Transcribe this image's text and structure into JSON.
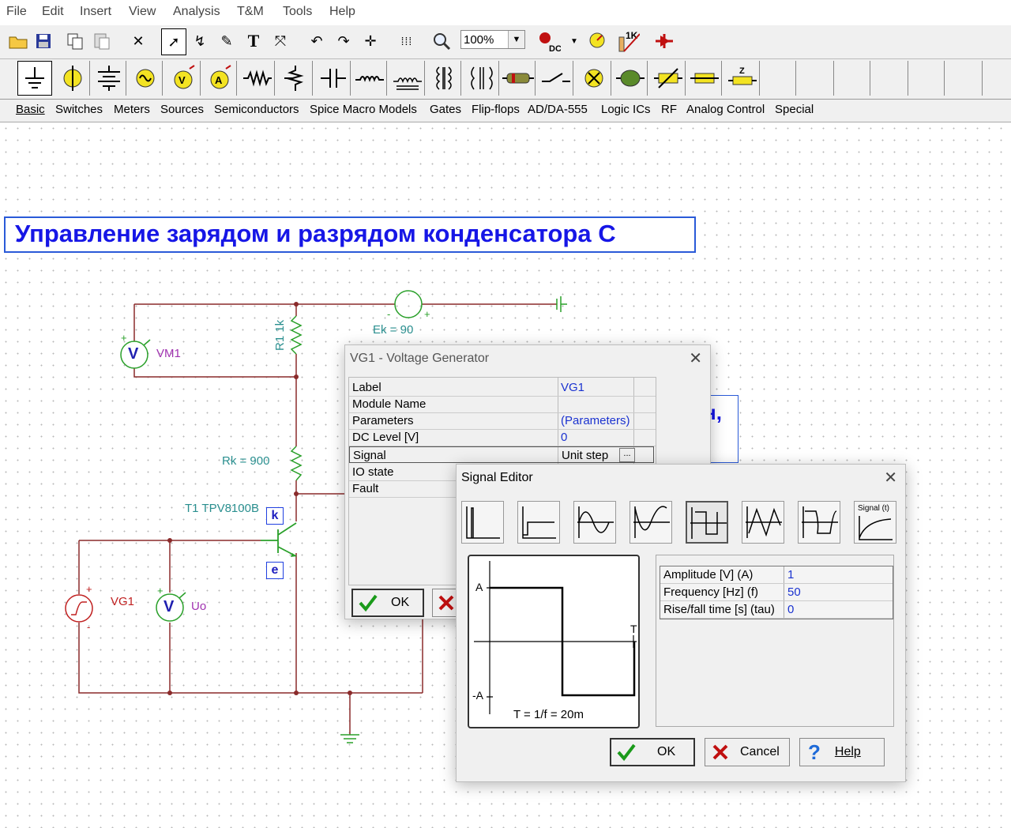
{
  "menu": [
    "File",
    "Edit",
    "Insert",
    "View",
    "Analysis",
    "T&M",
    "Tools",
    "Help"
  ],
  "toolbar": {
    "zoom": "100%"
  },
  "component_tabs": [
    "Basic",
    "Switches",
    "Meters",
    "Sources",
    "Semiconductors",
    "Spice Macro Models",
    "Gates",
    "Flip-flops",
    "AD/DA-555",
    "Logic ICs",
    "RF",
    "Analog Control",
    "Special"
  ],
  "schematic": {
    "title": "Управление зарядом и разрядом конденсатора С",
    "labels": {
      "ek": "Ek = 90",
      "r1": "R1 1k",
      "vm1": "VM1",
      "rk": "Rk = 900",
      "t1": "T1 TPV8100B",
      "k": "k",
      "e": "e",
      "vg1": "VG1",
      "uo": "Uo",
      "v": "V",
      "plus": "+",
      "minus": "-",
      "hidden_text": "н,"
    }
  },
  "vg_dialog": {
    "title": "VG1 - Voltage Generator",
    "rows": [
      {
        "name": "Label",
        "value": "VG1"
      },
      {
        "name": "Module Name",
        "value": ""
      },
      {
        "name": "Parameters",
        "value": "(Parameters)"
      },
      {
        "name": "DC Level [V]",
        "value": "0"
      },
      {
        "name": "Signal",
        "value": "Unit step"
      },
      {
        "name": "IO state",
        "value": ""
      },
      {
        "name": "Fault",
        "value": ""
      }
    ],
    "ok": "OK",
    "ellipsis": "..."
  },
  "signal_editor": {
    "title": "Signal Editor",
    "custom_label": "Signal (t)",
    "preview": {
      "a_label": "A",
      "neg_a_label": "-A",
      "t_label": "T",
      "period": "T = 1/f = 20m"
    },
    "params": [
      {
        "name": "Amplitude [V] (A)",
        "value": "1"
      },
      {
        "name": "Frequency [Hz] (f)",
        "value": "50"
      },
      {
        "name": "Rise/fall time [s] (tau)",
        "value": "0"
      }
    ],
    "ok": "OK",
    "cancel": "Cancel",
    "help": "Help"
  }
}
